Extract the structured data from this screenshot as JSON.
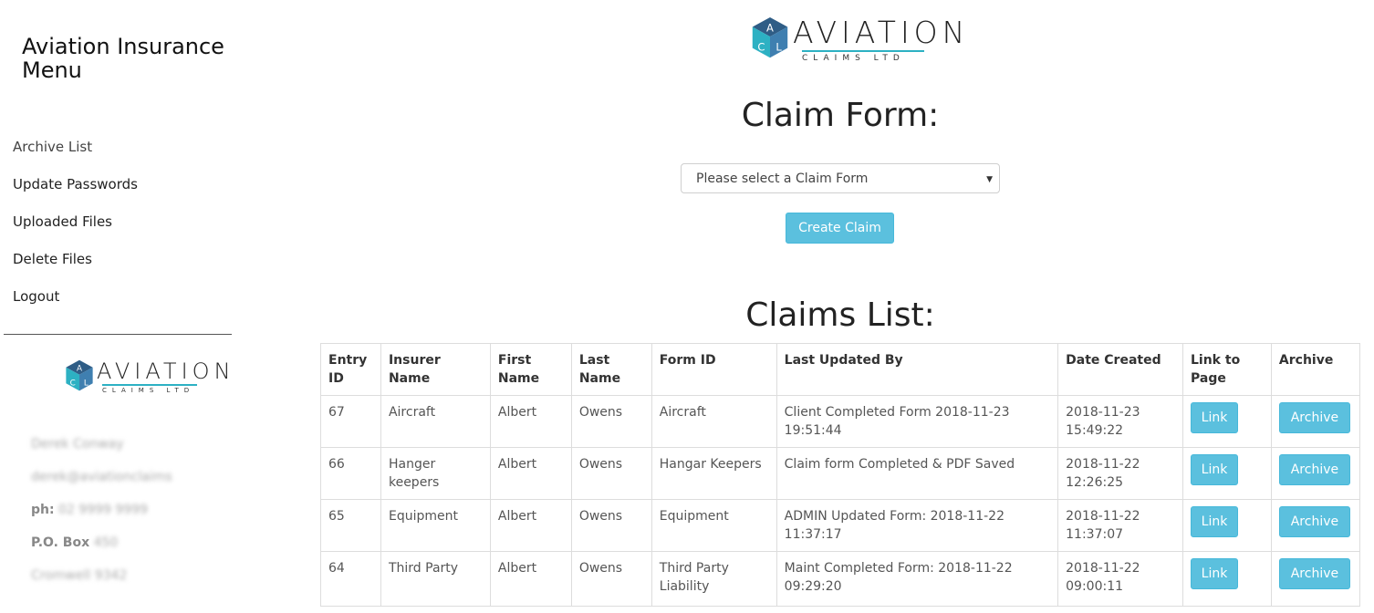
{
  "sidebar": {
    "title": "Aviation Insurance Menu",
    "nav": [
      "Archive List",
      "Update Passwords",
      "Uploaded Files",
      "Delete Files",
      "Logout"
    ],
    "contact": {
      "name": "Derek Conway",
      "email": "derek@aviationclaims",
      "phone_label": "ph:",
      "phone": "02 9999 9999",
      "po_label": "P.O. Box",
      "po": "450",
      "address": "Cromwell 9342"
    }
  },
  "logo": {
    "letters": [
      "A",
      "C",
      "L"
    ],
    "name": "AVIATION",
    "sub": "CLAIMS LTD"
  },
  "claim_form": {
    "heading": "Claim Form:",
    "select_placeholder": "Please select a Claim Form",
    "create_button": "Create Claim"
  },
  "claims_list": {
    "heading": "Claims List:",
    "columns": [
      "Entry ID",
      "Insurer Name",
      "First Name",
      "Last Name",
      "Form ID",
      "Last Updated By",
      "Date Created",
      "Link to Page",
      "Archive"
    ],
    "link_label": "Link",
    "archive_label": "Archive",
    "rows": [
      {
        "entry_id": "67",
        "insurer": "Aircraft",
        "first": "Albert",
        "last": "Owens",
        "form_id": "Aircraft",
        "updated_by": "Client Completed Form 2018-11-23 19:51:44",
        "created": "2018-11-23 15:49:22"
      },
      {
        "entry_id": "66",
        "insurer": "Hanger keepers",
        "first": "Albert",
        "last": "Owens",
        "form_id": "Hangar Keepers",
        "updated_by": "Claim form Completed & PDF Saved",
        "created": "2018-11-22 12:26:25"
      },
      {
        "entry_id": "65",
        "insurer": "Equipment",
        "first": "Albert",
        "last": "Owens",
        "form_id": "Equipment",
        "updated_by": "ADMIN Updated Form: 2018-11-22 11:37:17",
        "created": "2018-11-22 11:37:07"
      },
      {
        "entry_id": "64",
        "insurer": "Third Party",
        "first": "Albert",
        "last": "Owens",
        "form_id": "Third Party Liability",
        "updated_by": "Maint Completed Form: 2018-11-22 09:29:20",
        "created": "2018-11-22 09:00:11"
      }
    ]
  },
  "colors": {
    "accent": "#5bc0de",
    "cube_dark": "#2f5d86",
    "cube_light": "#2db1c3",
    "cube_mid": "#3f7fb0"
  }
}
